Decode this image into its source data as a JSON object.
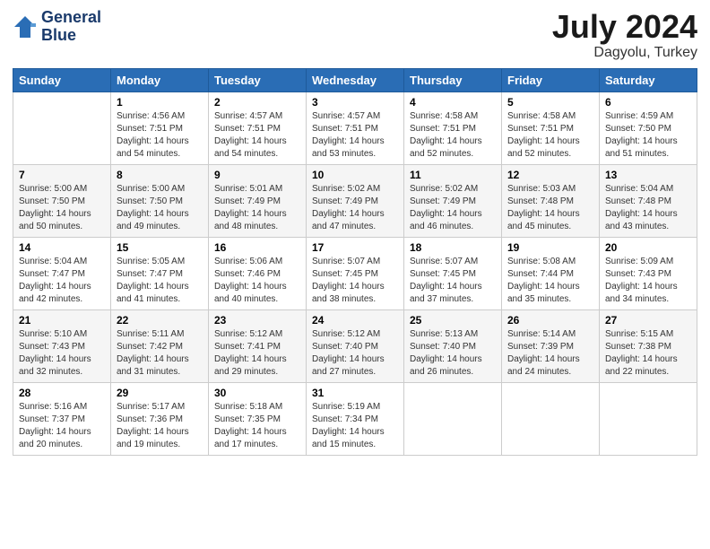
{
  "header": {
    "logo_line1": "General",
    "logo_line2": "Blue",
    "month": "July 2024",
    "location": "Dagyolu, Turkey"
  },
  "weekdays": [
    "Sunday",
    "Monday",
    "Tuesday",
    "Wednesday",
    "Thursday",
    "Friday",
    "Saturday"
  ],
  "weeks": [
    [
      {
        "day": "",
        "info": ""
      },
      {
        "day": "1",
        "info": "Sunrise: 4:56 AM\nSunset: 7:51 PM\nDaylight: 14 hours\nand 54 minutes."
      },
      {
        "day": "2",
        "info": "Sunrise: 4:57 AM\nSunset: 7:51 PM\nDaylight: 14 hours\nand 54 minutes."
      },
      {
        "day": "3",
        "info": "Sunrise: 4:57 AM\nSunset: 7:51 PM\nDaylight: 14 hours\nand 53 minutes."
      },
      {
        "day": "4",
        "info": "Sunrise: 4:58 AM\nSunset: 7:51 PM\nDaylight: 14 hours\nand 52 minutes."
      },
      {
        "day": "5",
        "info": "Sunrise: 4:58 AM\nSunset: 7:51 PM\nDaylight: 14 hours\nand 52 minutes."
      },
      {
        "day": "6",
        "info": "Sunrise: 4:59 AM\nSunset: 7:50 PM\nDaylight: 14 hours\nand 51 minutes."
      }
    ],
    [
      {
        "day": "7",
        "info": "Sunrise: 5:00 AM\nSunset: 7:50 PM\nDaylight: 14 hours\nand 50 minutes."
      },
      {
        "day": "8",
        "info": "Sunrise: 5:00 AM\nSunset: 7:50 PM\nDaylight: 14 hours\nand 49 minutes."
      },
      {
        "day": "9",
        "info": "Sunrise: 5:01 AM\nSunset: 7:49 PM\nDaylight: 14 hours\nand 48 minutes."
      },
      {
        "day": "10",
        "info": "Sunrise: 5:02 AM\nSunset: 7:49 PM\nDaylight: 14 hours\nand 47 minutes."
      },
      {
        "day": "11",
        "info": "Sunrise: 5:02 AM\nSunset: 7:49 PM\nDaylight: 14 hours\nand 46 minutes."
      },
      {
        "day": "12",
        "info": "Sunrise: 5:03 AM\nSunset: 7:48 PM\nDaylight: 14 hours\nand 45 minutes."
      },
      {
        "day": "13",
        "info": "Sunrise: 5:04 AM\nSunset: 7:48 PM\nDaylight: 14 hours\nand 43 minutes."
      }
    ],
    [
      {
        "day": "14",
        "info": "Sunrise: 5:04 AM\nSunset: 7:47 PM\nDaylight: 14 hours\nand 42 minutes."
      },
      {
        "day": "15",
        "info": "Sunrise: 5:05 AM\nSunset: 7:47 PM\nDaylight: 14 hours\nand 41 minutes."
      },
      {
        "day": "16",
        "info": "Sunrise: 5:06 AM\nSunset: 7:46 PM\nDaylight: 14 hours\nand 40 minutes."
      },
      {
        "day": "17",
        "info": "Sunrise: 5:07 AM\nSunset: 7:45 PM\nDaylight: 14 hours\nand 38 minutes."
      },
      {
        "day": "18",
        "info": "Sunrise: 5:07 AM\nSunset: 7:45 PM\nDaylight: 14 hours\nand 37 minutes."
      },
      {
        "day": "19",
        "info": "Sunrise: 5:08 AM\nSunset: 7:44 PM\nDaylight: 14 hours\nand 35 minutes."
      },
      {
        "day": "20",
        "info": "Sunrise: 5:09 AM\nSunset: 7:43 PM\nDaylight: 14 hours\nand 34 minutes."
      }
    ],
    [
      {
        "day": "21",
        "info": "Sunrise: 5:10 AM\nSunset: 7:43 PM\nDaylight: 14 hours\nand 32 minutes."
      },
      {
        "day": "22",
        "info": "Sunrise: 5:11 AM\nSunset: 7:42 PM\nDaylight: 14 hours\nand 31 minutes."
      },
      {
        "day": "23",
        "info": "Sunrise: 5:12 AM\nSunset: 7:41 PM\nDaylight: 14 hours\nand 29 minutes."
      },
      {
        "day": "24",
        "info": "Sunrise: 5:12 AM\nSunset: 7:40 PM\nDaylight: 14 hours\nand 27 minutes."
      },
      {
        "day": "25",
        "info": "Sunrise: 5:13 AM\nSunset: 7:40 PM\nDaylight: 14 hours\nand 26 minutes."
      },
      {
        "day": "26",
        "info": "Sunrise: 5:14 AM\nSunset: 7:39 PM\nDaylight: 14 hours\nand 24 minutes."
      },
      {
        "day": "27",
        "info": "Sunrise: 5:15 AM\nSunset: 7:38 PM\nDaylight: 14 hours\nand 22 minutes."
      }
    ],
    [
      {
        "day": "28",
        "info": "Sunrise: 5:16 AM\nSunset: 7:37 PM\nDaylight: 14 hours\nand 20 minutes."
      },
      {
        "day": "29",
        "info": "Sunrise: 5:17 AM\nSunset: 7:36 PM\nDaylight: 14 hours\nand 19 minutes."
      },
      {
        "day": "30",
        "info": "Sunrise: 5:18 AM\nSunset: 7:35 PM\nDaylight: 14 hours\nand 17 minutes."
      },
      {
        "day": "31",
        "info": "Sunrise: 5:19 AM\nSunset: 7:34 PM\nDaylight: 14 hours\nand 15 minutes."
      },
      {
        "day": "",
        "info": ""
      },
      {
        "day": "",
        "info": ""
      },
      {
        "day": "",
        "info": ""
      }
    ]
  ]
}
